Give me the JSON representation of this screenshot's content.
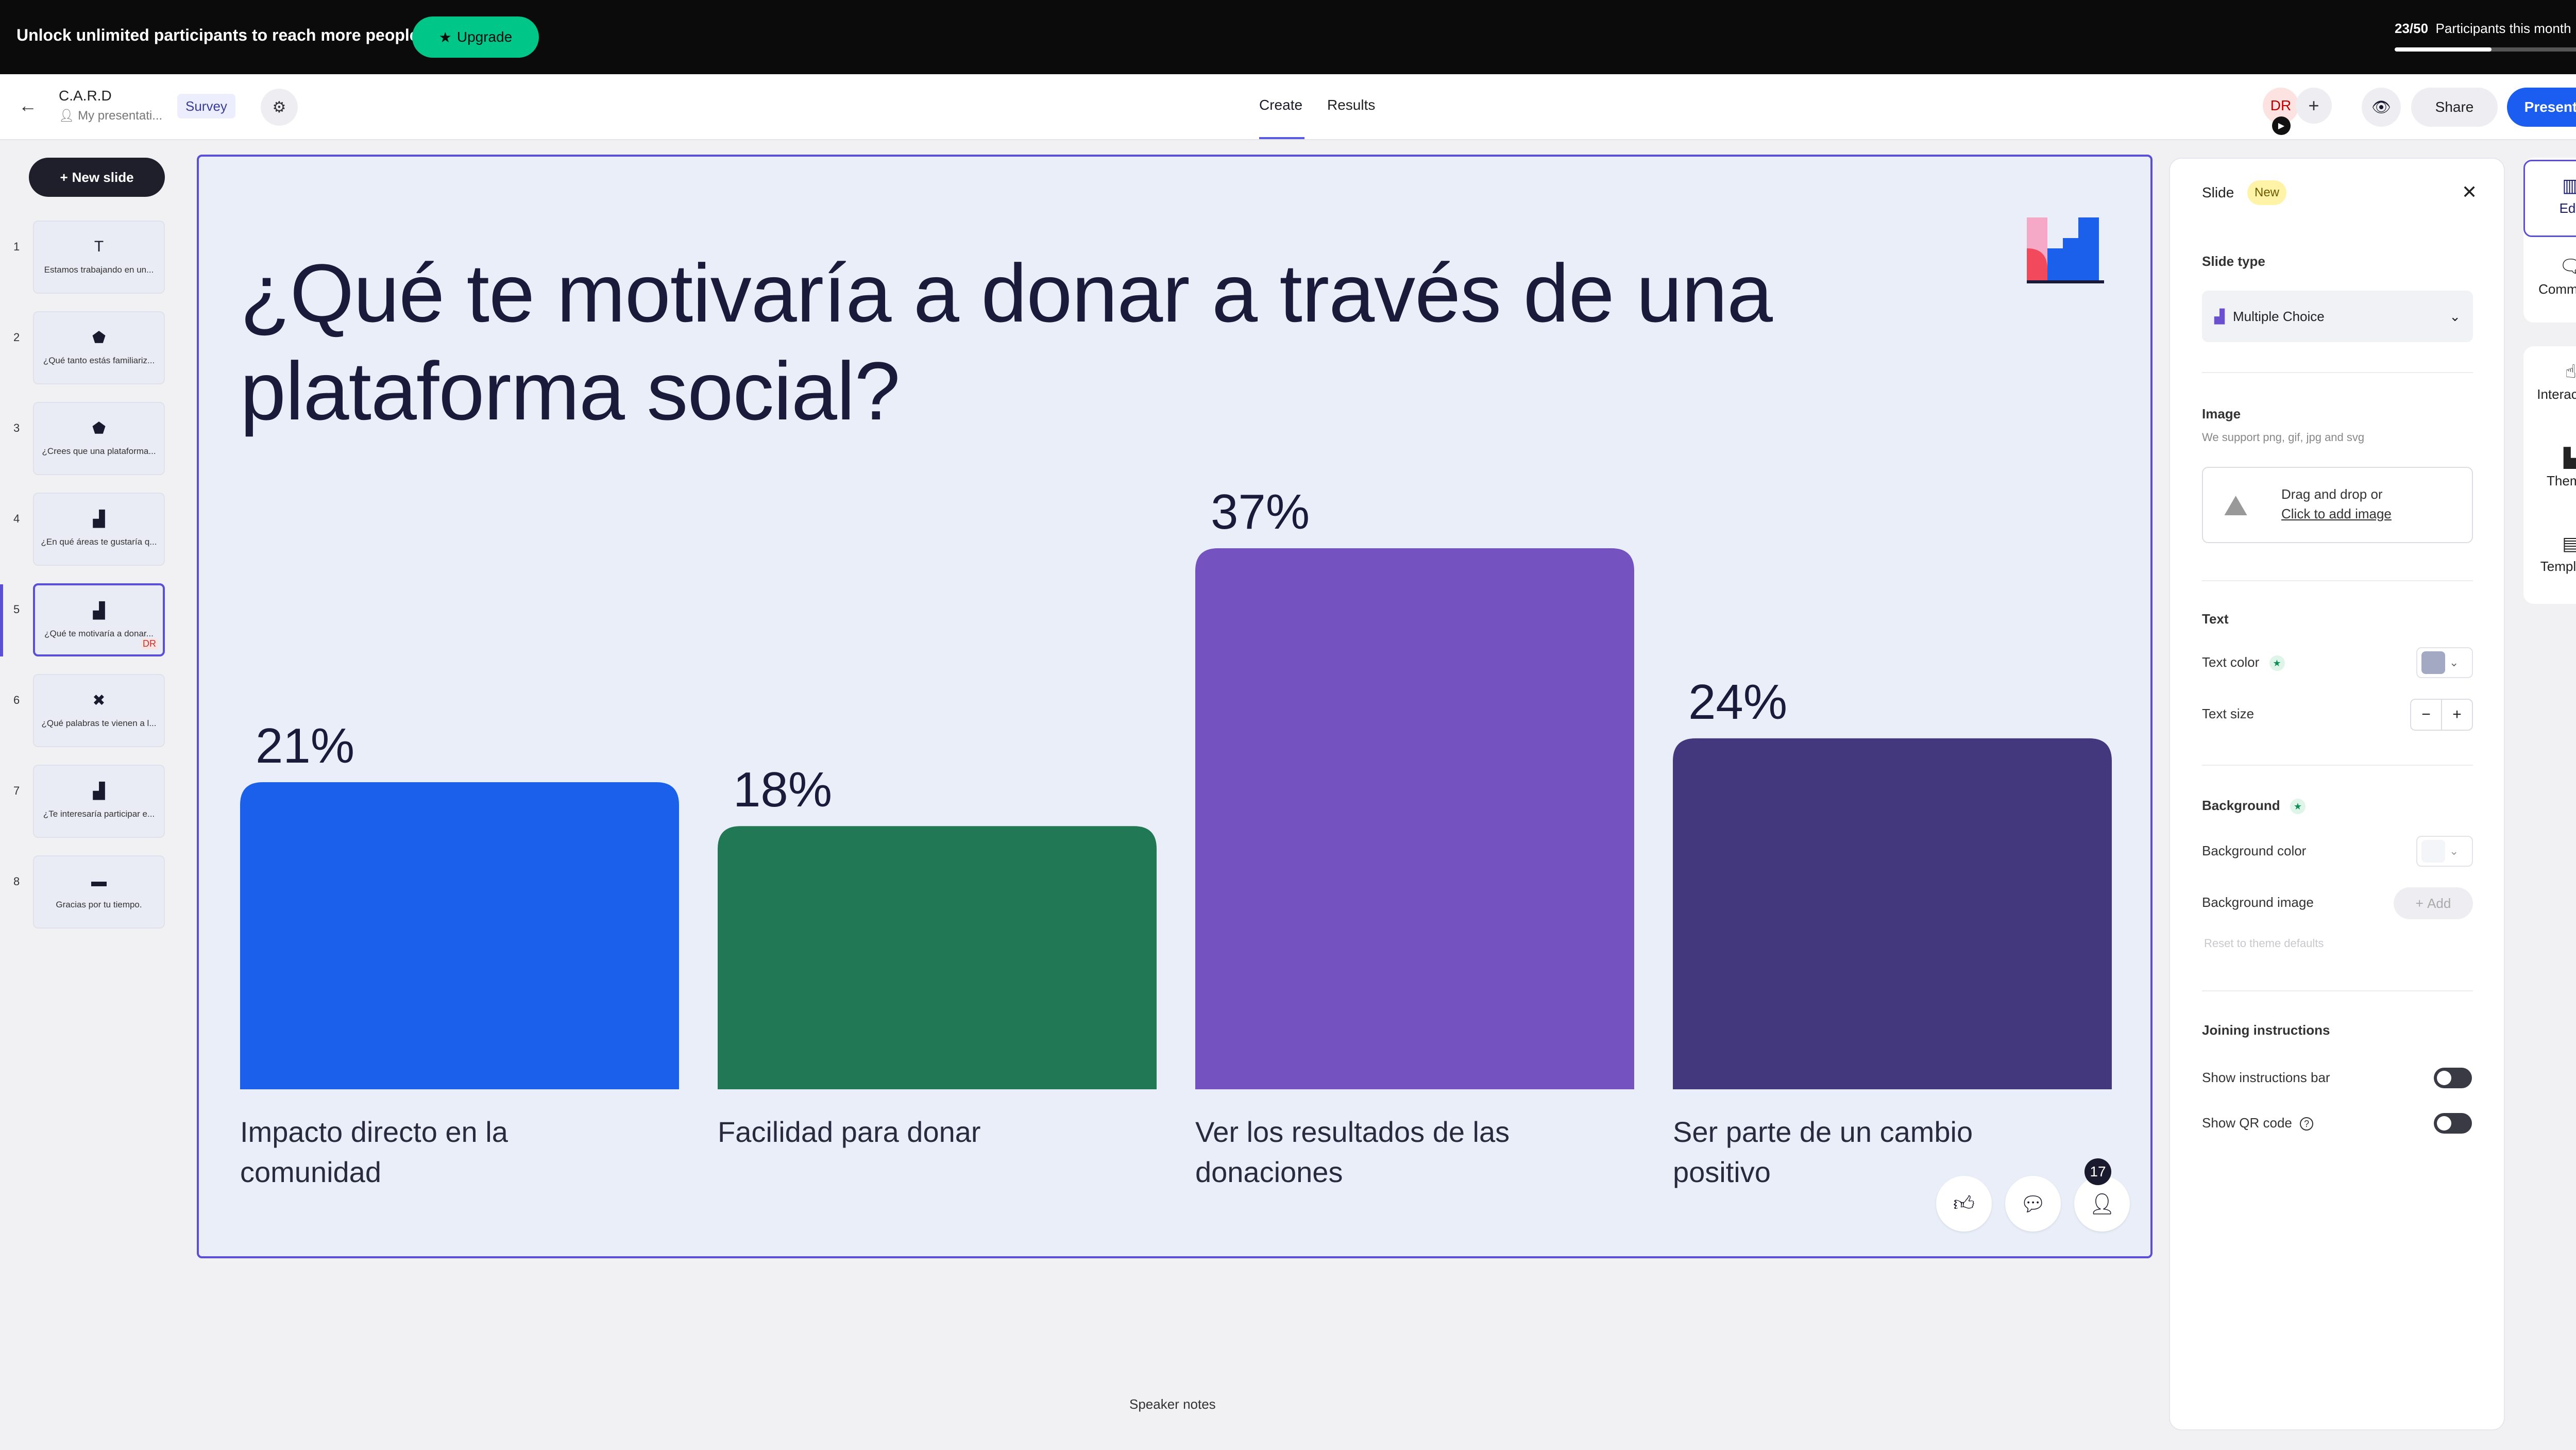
{
  "banner": {
    "text": "Unlock unlimited participants to reach more people.",
    "upgrade_label": "Upgrade",
    "participants_count": "23/50",
    "participants_label": "Participants this month",
    "participants_fraction": 0.46
  },
  "header": {
    "title": "C.A.R.D",
    "owner": "My presentati...",
    "type_badge": "Survey",
    "tabs": [
      "Create",
      "Results"
    ],
    "avatar_initials": "DR",
    "share_label": "Share",
    "present_label": "Present"
  },
  "sidebar": {
    "new_slide_label": "New slide",
    "slides": [
      {
        "num": "1",
        "icon": "heading-icon",
        "glyph": "T",
        "text": "Estamos trabajando en un..."
      },
      {
        "num": "2",
        "icon": "scales-icon",
        "glyph": "⬟",
        "text": "¿Qué tanto estás familiariz..."
      },
      {
        "num": "3",
        "icon": "scales-icon",
        "glyph": "⬟",
        "text": "¿Crees que una plataforma..."
      },
      {
        "num": "4",
        "icon": "bar-chart-icon",
        "glyph": "▟",
        "text": "¿En qué áreas te gustaría q..."
      },
      {
        "num": "5",
        "icon": "bar-chart-icon",
        "glyph": "▟",
        "text": "¿Qué te motivaría a donar...",
        "badge": "DR"
      },
      {
        "num": "6",
        "icon": "word-cloud-icon",
        "glyph": "✖",
        "text": "¿Qué palabras te vienen a l..."
      },
      {
        "num": "7",
        "icon": "bar-chart-icon",
        "glyph": "▟",
        "text": "¿Te interesaría participar e..."
      },
      {
        "num": "8",
        "icon": "monitor-icon",
        "glyph": "▬",
        "text": "Gracias por tu tiempo."
      }
    ]
  },
  "slide": {
    "title": "¿Qué te motivaría a donar a través de una plataforma social?",
    "participant_count": "17",
    "speaker_notes": "Speaker notes"
  },
  "chart_data": {
    "type": "bar",
    "categories": [
      "Impacto directo en la comunidad",
      "Facilidad para donar",
      "Ver los resultados de las donaciones",
      "Ser parte de un cambio positivo"
    ],
    "values": [
      21,
      18,
      37,
      24
    ],
    "value_labels": [
      "21%",
      "18%",
      "37%",
      "24%"
    ],
    "colors": [
      "#1a60ea",
      "#217854",
      "#7452bf",
      "#43387e"
    ],
    "ylim": [
      0,
      37
    ],
    "grid": false,
    "legend": "none"
  },
  "panel": {
    "title": "Slide",
    "new_badge": "New",
    "slide_type_label": "Slide type",
    "slide_type_value": "Multiple Choice",
    "image_label": "Image",
    "image_hint": "We support png, gif, jpg and svg",
    "dropzone_text": "Drag and drop or",
    "dropzone_link": "Click to add image",
    "text_section": "Text",
    "text_color_label": "Text color",
    "text_size_label": "Text size",
    "background_section": "Background",
    "background_color_label": "Background color",
    "background_image_label": "Background image",
    "add_label": "Add",
    "reset_label": "Reset to theme defaults",
    "joining_section": "Joining instructions",
    "show_bar_label": "Show instructions bar",
    "show_qr_label": "Show QR code",
    "text_color_value": "#a3a9c2",
    "background_color_value": "#f4f5f9"
  },
  "rail": {
    "items": [
      "Edit",
      "Comments",
      "Interactivity",
      "Themes",
      "Templates"
    ]
  }
}
